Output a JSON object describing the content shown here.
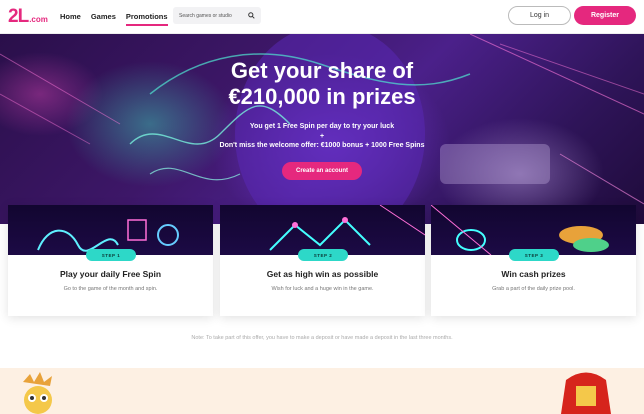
{
  "header": {
    "logo_main": "2L",
    "logo_suffix": ".com",
    "nav": [
      "Home",
      "Games",
      "Promotions"
    ],
    "search_placeholder": "Search games or studio",
    "login_label": "Log in",
    "register_label": "Register"
  },
  "hero": {
    "title_line1": "Get your share of",
    "title_line2": "€210,000 in prizes",
    "sub_line1": "You get 1 Free Spin per day to try your luck",
    "sub_line2": "+",
    "sub_line3": "Don't miss the welcome offer: €1000 bonus + 1000 Free Spins",
    "cta_label": "Create an account"
  },
  "steps": [
    {
      "badge": "STEP 1",
      "title": "Play your daily Free Spin",
      "desc": "Go to the game of the month and spin."
    },
    {
      "badge": "STEP 2",
      "title": "Get as high win as possible",
      "desc": "Wish for luck and a huge win in the game."
    },
    {
      "badge": "STEP 3",
      "title": "Win cash prizes",
      "desc": "Grab a part of the daily prize pool."
    }
  ],
  "note": "Note: To take part of this offer, you have to make a deposit or have made a deposit in the last three months.",
  "colors": {
    "brand": "#e5287e",
    "step_badge": "#2dd8c8"
  }
}
